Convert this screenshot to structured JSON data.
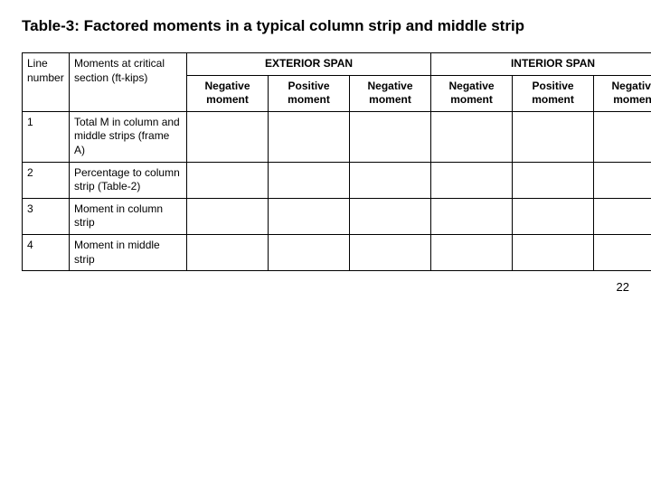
{
  "title": "Table-3: Factored moments in a typical column strip and middle strip",
  "table": {
    "exterior_span_label": "EXTERIOR SPAN",
    "interior_span_label": "INTERIOR SPAN",
    "col_headers": [
      "Line number",
      "Moments at critical section (ft-kips)",
      "Negative moment",
      "Positive moment",
      "Negative moment",
      "Negative moment",
      "Positive moment",
      "Negative moment"
    ],
    "rows": [
      {
        "line": "1",
        "description": "Total M in column and middle strips (frame A)"
      },
      {
        "line": "2",
        "description": "Percentage to column strip (Table-2)"
      },
      {
        "line": "3",
        "description": "Moment in column strip"
      },
      {
        "line": "4",
        "description": "Moment in middle strip"
      }
    ]
  },
  "page_number": "22"
}
